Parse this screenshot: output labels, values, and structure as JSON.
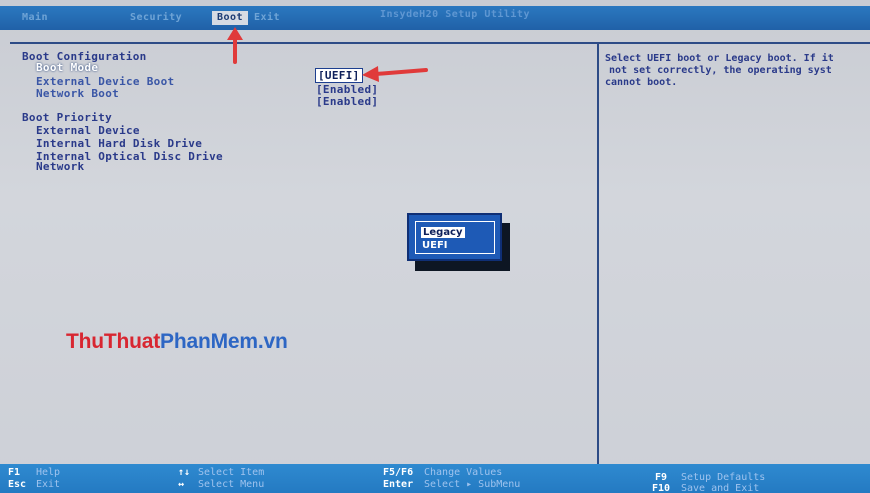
{
  "topbar": {
    "tabs": [
      "Main",
      "Security",
      "Boot",
      "Exit"
    ],
    "active_tab": "Boot",
    "utility_title": "InsydeH20 Setup Utility"
  },
  "boot_configuration": {
    "header": "Boot Configuration",
    "items": [
      {
        "label": "Boot Mode",
        "value": "[UEFI]"
      },
      {
        "label": "External Device Boot",
        "value": "[Enabled]"
      },
      {
        "label": "Network Boot",
        "value": "[Enabled]"
      }
    ]
  },
  "boot_priority": {
    "header": "Boot Priority",
    "items": [
      "External Device",
      "Internal Hard Disk Drive",
      "Internal Optical Disc Drive",
      "Network"
    ]
  },
  "help_text": [
    "Select UEFI boot or Legacy boot. If it",
    "not set correctly, the operating syst",
    "cannot boot."
  ],
  "popup": {
    "options": [
      "Legacy",
      "UEFI"
    ],
    "highlighted": "Legacy"
  },
  "watermark": {
    "part1": "ThuThuat",
    "part2": "PhanMem.vn"
  },
  "footer": {
    "f1_key": "F1",
    "f1_desc": "Help",
    "esc_key": "Esc",
    "esc_desc": "Exit",
    "updown_key": "↑↓",
    "updown_desc": "Select Item",
    "leftright_key": "↔",
    "leftright_desc": "Select Menu",
    "f5f6_key": "F5/F6",
    "f5f6_desc": "Change Values",
    "enter_key": "Enter",
    "enter_desc": "Select ▸ SubMenu",
    "f9_key": "F9",
    "f9_desc": "Setup Defaults",
    "f10_key": "F10",
    "f10_desc": "Save and Exit"
  },
  "colors": {
    "bar_blue": "#2b78c0",
    "bg_gray": "#cdd0d7",
    "text_blue": "#2a3a8a",
    "arrow_red": "#e03a3a"
  }
}
